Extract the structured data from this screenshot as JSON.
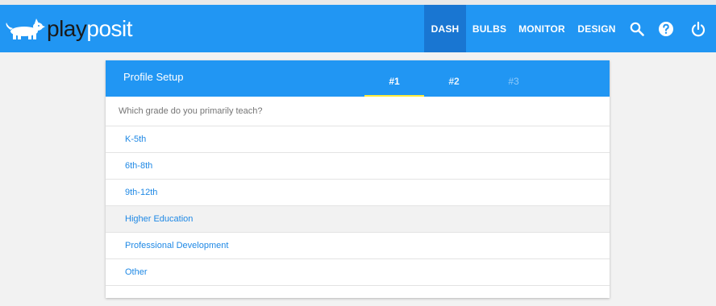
{
  "app": {
    "logo_part1": "play",
    "logo_part2": "posit",
    "brand_color": "#2196f3",
    "active_nav_color": "#1976d2"
  },
  "nav": {
    "items": [
      {
        "label": "DASH",
        "active": true
      },
      {
        "label": "BULBS",
        "active": false
      },
      {
        "label": "MONITOR",
        "active": false
      },
      {
        "label": "DESIGN",
        "active": false
      }
    ],
    "icons": [
      "search-icon",
      "help-icon",
      "power-icon"
    ]
  },
  "card": {
    "title": "Profile Setup",
    "steps": [
      {
        "label": "#1",
        "state": "active"
      },
      {
        "label": "#2",
        "state": "enabled"
      },
      {
        "label": "#3",
        "state": "disabled"
      }
    ],
    "question": "Which grade do you primarily teach?",
    "options": [
      {
        "label": "K-5th"
      },
      {
        "label": "6th-8th"
      },
      {
        "label": "9th-12th"
      },
      {
        "label": "Higher Education",
        "hovered": true
      },
      {
        "label": "Professional Development"
      },
      {
        "label": "Other"
      }
    ],
    "step_underline_color": "#ffeb3b"
  }
}
